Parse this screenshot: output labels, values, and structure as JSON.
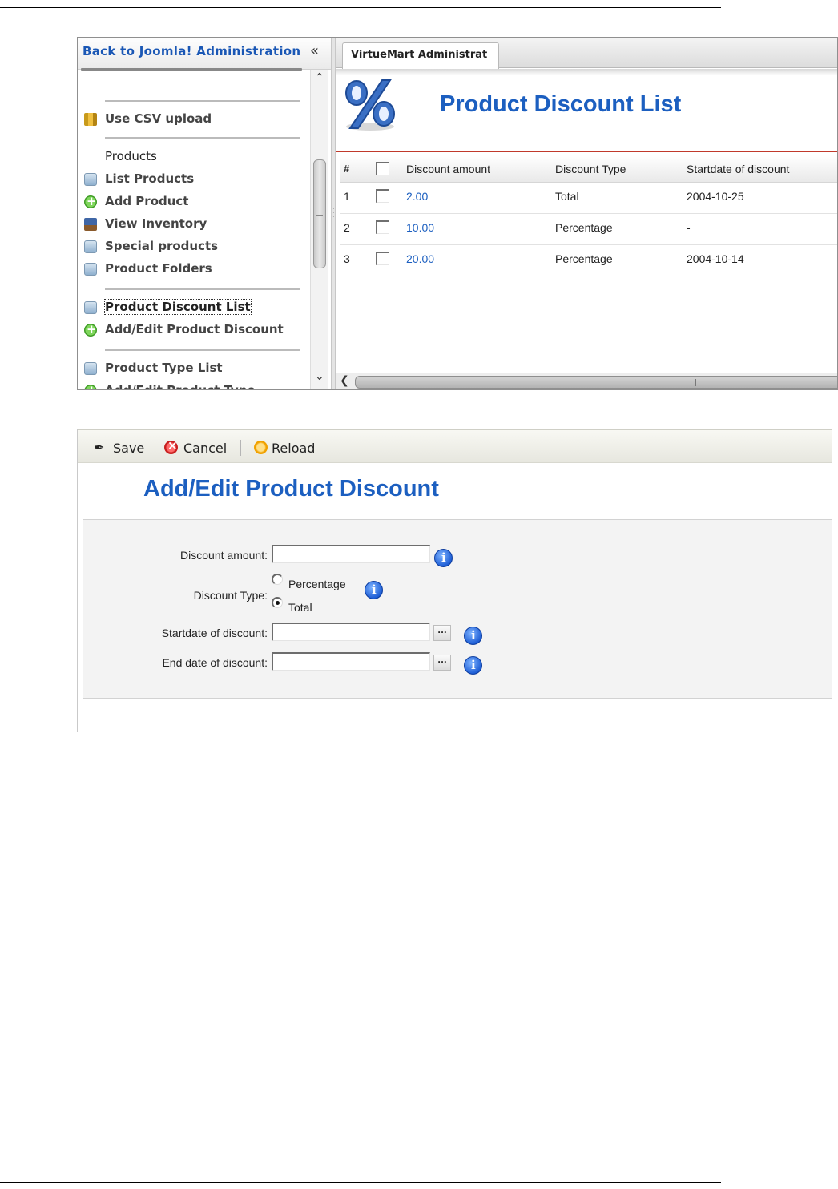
{
  "sidebar": {
    "back_link": "Back to Joomla! Administration",
    "collapse_glyph": "«",
    "items": [
      {
        "label": "Use CSV upload",
        "icon": "csv-upload-icon"
      },
      {
        "label": "Products",
        "icon": ""
      },
      {
        "label": "List Products",
        "icon": "list-icon"
      },
      {
        "label": "Add Product",
        "icon": "add-icon"
      },
      {
        "label": "View Inventory",
        "icon": "inventory-icon"
      },
      {
        "label": "Special products",
        "icon": "list-icon"
      },
      {
        "label": "Product Folders",
        "icon": "list-icon"
      },
      {
        "label": "Product Discount List",
        "icon": "list-icon"
      },
      {
        "label": "Add/Edit Product Discount",
        "icon": "add-icon"
      },
      {
        "label": "Product Type List",
        "icon": "list-icon"
      },
      {
        "label": "Add/Edit Product Type",
        "icon": "add-icon"
      }
    ],
    "active_item": "Product Discount List"
  },
  "tabs": [
    {
      "label": "VirtueMart Administrat"
    }
  ],
  "discount_list": {
    "title": "Product Discount List",
    "columns": [
      "#",
      "Discount amount",
      "Discount Type",
      "Startdate of discount"
    ],
    "rows": [
      {
        "num": "1",
        "amount": "2.00",
        "type": "Total",
        "start": "2004-10-25"
      },
      {
        "num": "2",
        "amount": "10.00",
        "type": "Percentage",
        "start": "-"
      },
      {
        "num": "3",
        "amount": "20.00",
        "type": "Percentage",
        "start": "2004-10-14"
      }
    ]
  },
  "toolbar": {
    "save_label": "Save",
    "cancel_label": "Cancel",
    "reload_label": "Reload"
  },
  "edit_form": {
    "title": "Add/Edit Product Discount",
    "amount_label": "Discount amount:",
    "type_label": "Discount Type:",
    "type_options": [
      "Percentage",
      "Total"
    ],
    "type_selected": "Total",
    "start_label": "Startdate of discount:",
    "end_label": "End date of discount:",
    "picker_label": "...",
    "amount_value": "",
    "start_value": "",
    "end_value": ""
  },
  "colors": {
    "title_blue": "#1c5fc0",
    "link_blue": "#1a57b5",
    "accent_red": "#c0392b"
  }
}
